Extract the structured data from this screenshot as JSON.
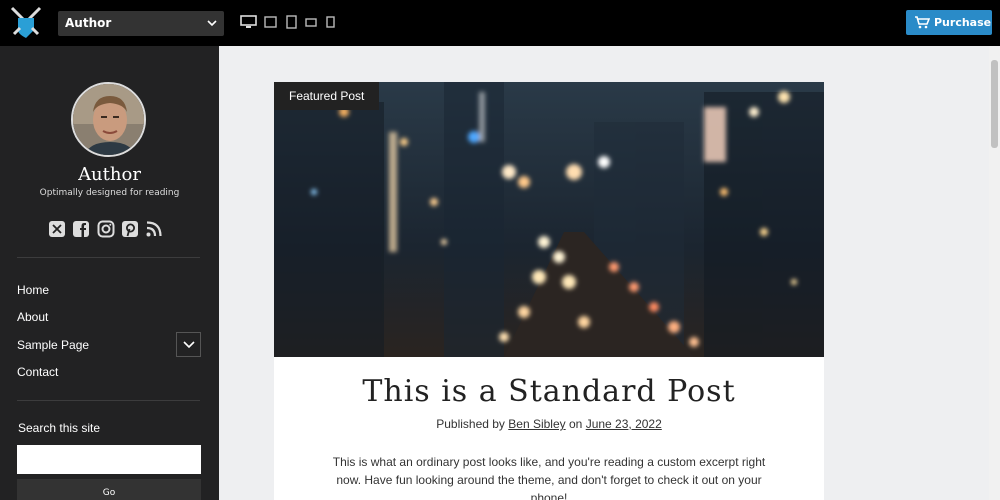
{
  "topbar": {
    "theme_select": "Author",
    "purchase_label": "Purchase",
    "colors": {
      "background": "#000000",
      "purchase": "#2a8bc8"
    }
  },
  "sidebar": {
    "site_title": "Author",
    "tagline": "Optimally designed for reading",
    "social_icons": [
      "x-icon",
      "facebook-icon",
      "instagram-icon",
      "pinterest-icon",
      "rss-icon"
    ],
    "nav": [
      {
        "label": "Home"
      },
      {
        "label": "About"
      },
      {
        "label": "Sample Page",
        "has_submenu": true
      },
      {
        "label": "Contact"
      }
    ],
    "search": {
      "label": "Search this site",
      "placeholder": "",
      "button": "Go"
    }
  },
  "post": {
    "featured_label": "Featured Post",
    "title": "This is a Standard Post",
    "byline_prefix": "Published by",
    "author": "Ben Sibley",
    "byline_middle": "on",
    "date": "June 23, 2022",
    "excerpt": "This is what an ordinary post looks like, and you're reading a custom excerpt right now. Have fun looking around the theme, and don't forget to check it out on your phone!"
  }
}
